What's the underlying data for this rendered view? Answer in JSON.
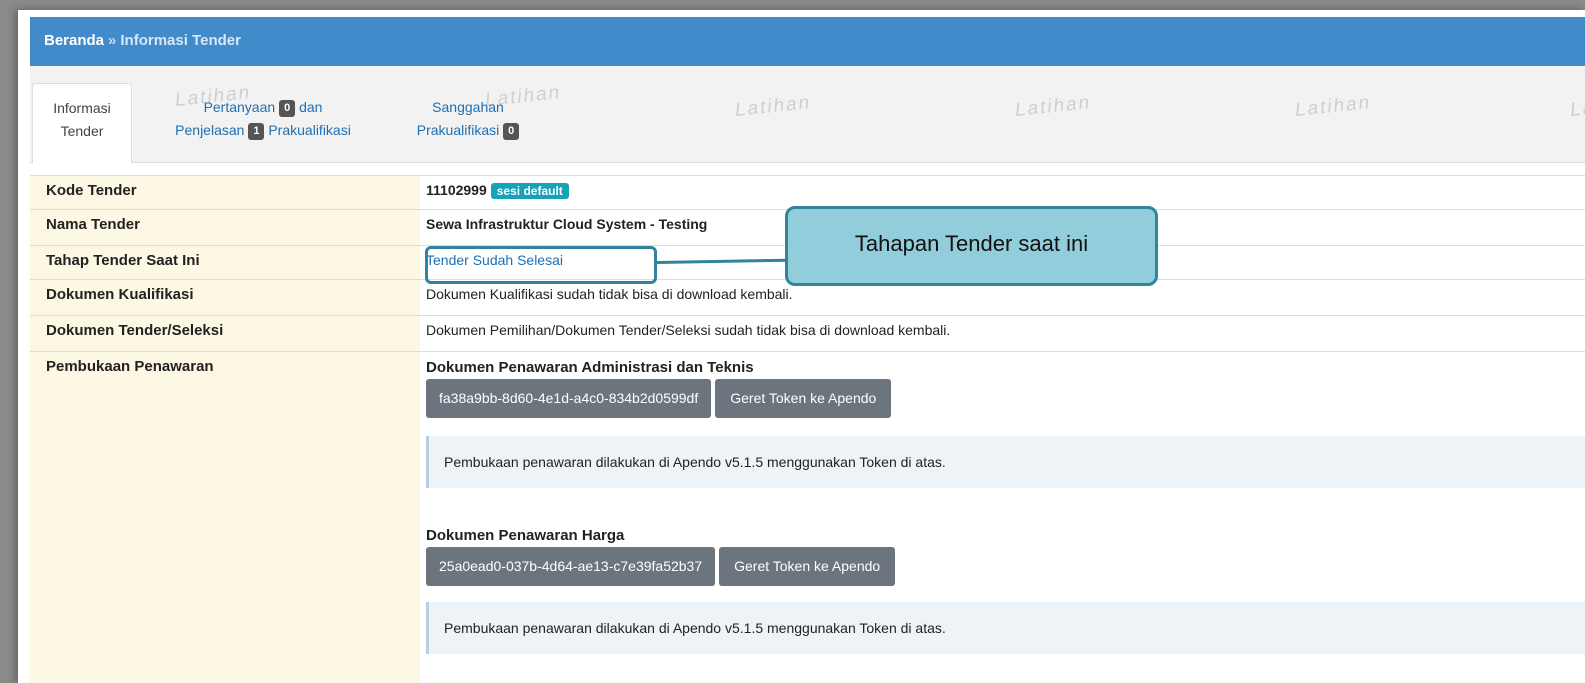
{
  "breadcrumb": {
    "home": "Beranda",
    "separator": "»",
    "current": "Informasi Tender"
  },
  "tabs": {
    "info_line1": "Informasi",
    "info_line2": "Tender",
    "tanya_line1a": "Pertanyaan",
    "tanya_badge": "0",
    "tanya_line1b": "dan",
    "tanya_line2a": "Penjelasan",
    "tanya_badge2": "1",
    "tanya_line2b": "Prakualifikasi",
    "sanggah_line1": "Sanggahan",
    "sanggah_line2": "Prakualifikasi",
    "sanggah_badge": "0"
  },
  "watermark": "Latihan",
  "rows": {
    "kode_label": "Kode Tender",
    "kode_value": "11102999",
    "kode_badge": "sesi default",
    "nama_label": "Nama Tender",
    "nama_value": "Sewa Infrastruktur Cloud System - Testing",
    "tahap_label": "Tahap Tender Saat Ini",
    "tahap_value": "Tender Sudah Selesai",
    "kual_label": "Dokumen Kualifikasi",
    "kual_value": "Dokumen Kualifikasi sudah tidak bisa di download kembali.",
    "tender_label": "Dokumen Tender/Seleksi",
    "tender_value": "Dokumen Pemilihan/Dokumen Tender/Seleksi sudah tidak bisa di download kembali.",
    "buka_label": "Pembukaan Penawaran"
  },
  "penawaran": {
    "admin_title": "Dokumen Penawaran Administrasi dan Teknis",
    "admin_token": "fa38a9bb-8d60-4e1d-a4c0-834b2d0599df",
    "harga_title": "Dokumen Penawaran Harga",
    "harga_token": "25a0ead0-037b-4d64-ae13-c7e39fa52b37",
    "apendo_button": "Geret Token ke Apendo",
    "info_text": "Pembukaan penawaran dilakukan di Apendo v5.1.5 menggunakan Token di atas."
  },
  "callout": {
    "text": "Tahapan Tender saat ini"
  },
  "colors": {
    "header": "#428bca",
    "label_bg": "#fcf8e3",
    "callout_fill": "#92cddc",
    "callout_border": "#31849b",
    "badge_teal": "#17a2b8"
  }
}
